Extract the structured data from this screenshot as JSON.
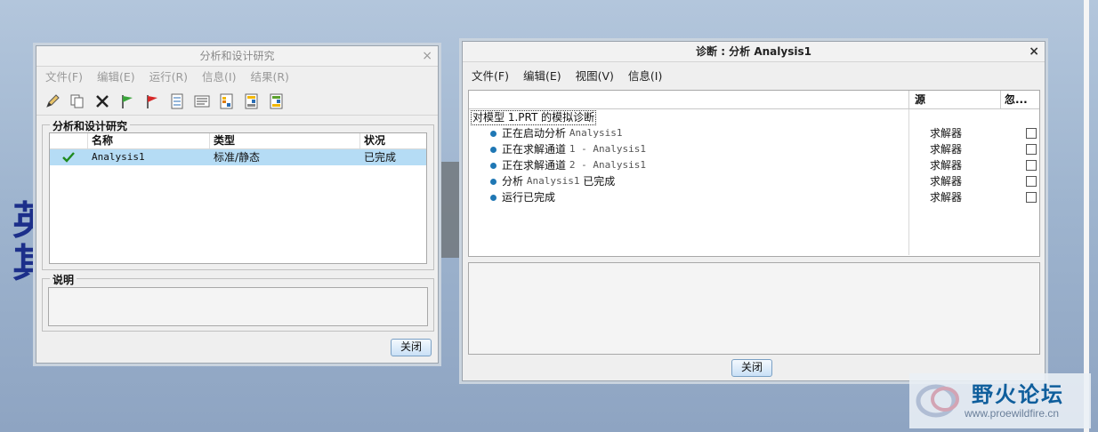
{
  "bg": {
    "partial_text": "英\n其"
  },
  "left": {
    "title": "分析和设计研究",
    "close": "×",
    "menu": [
      "文件(F)",
      "编辑(E)",
      "运行(R)",
      "信息(I)",
      "结果(R)"
    ],
    "group_label": "分析和设计研究",
    "columns": [
      "名称",
      "类型",
      "状况"
    ],
    "rows": [
      {
        "status_icon": "check-icon",
        "name": "Analysis1",
        "type": "标准/静态",
        "state": "已完成"
      }
    ],
    "desc_label": "说明",
    "close_button": "关闭"
  },
  "right": {
    "title": "诊断 : 分析 Analysis1",
    "close": "×",
    "menu": [
      "文件(F)",
      "编辑(E)",
      "视图(V)",
      "信息(I)"
    ],
    "columns": [
      "",
      "源",
      "忽..."
    ],
    "root": "对模型 1.PRT 的模拟诊断",
    "items": [
      {
        "label": "正在启动分析",
        "mono": "Analysis1",
        "tail": "",
        "source": "求解器"
      },
      {
        "label": "正在求解通道",
        "mono": "1 - Analysis1",
        "tail": "",
        "source": "求解器"
      },
      {
        "label": "正在求解通道",
        "mono": "2 - Analysis1",
        "tail": "",
        "source": "求解器"
      },
      {
        "label": "分析",
        "mono": "Analysis1",
        "tail": "已完成",
        "source": "求解器"
      },
      {
        "label": "运行已完成",
        "mono": "",
        "tail": "",
        "source": "求解器"
      }
    ],
    "close_button": "关闭"
  },
  "watermark": {
    "brand": "野火论坛",
    "url": "www.proewildfire.cn"
  },
  "colors": {
    "accent": "#1f77b4",
    "selection": "#b5dcf5",
    "brand": "#0f5e9c"
  }
}
